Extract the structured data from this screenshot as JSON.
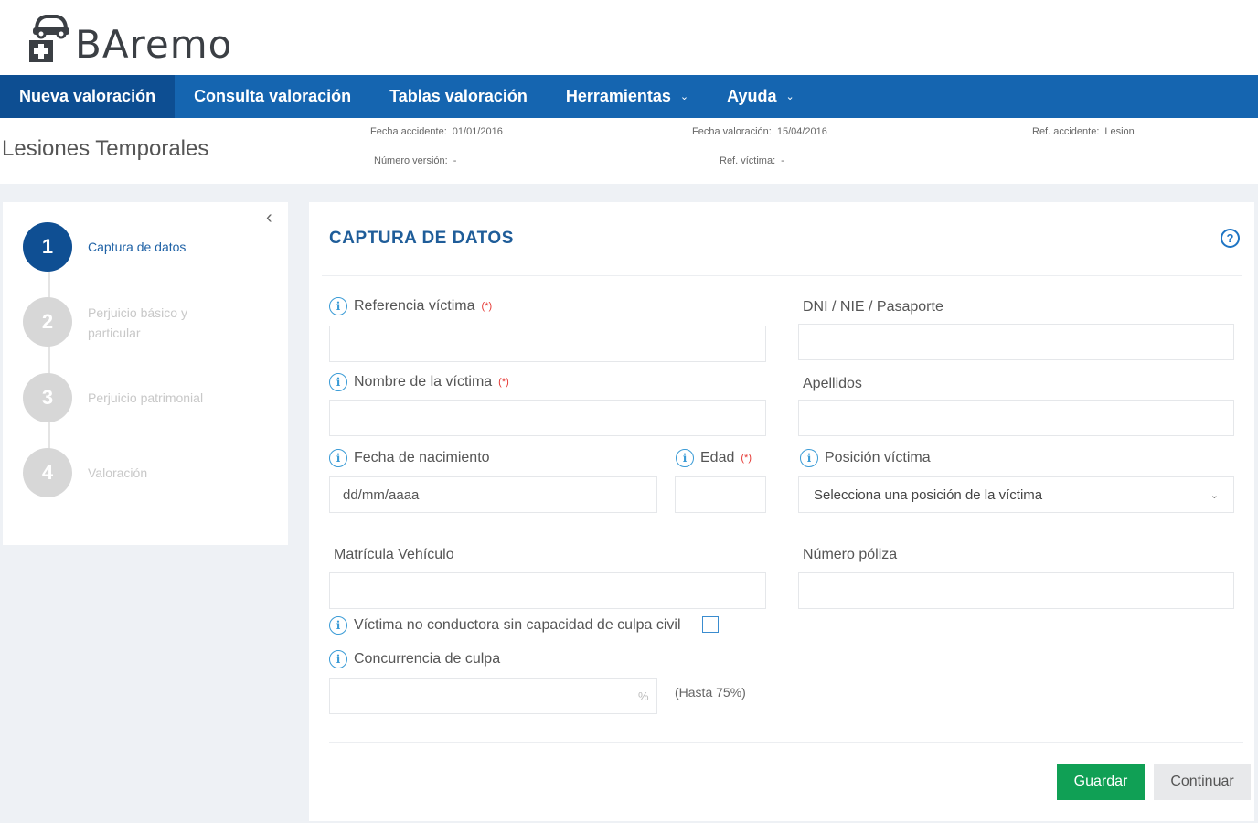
{
  "brand": {
    "name": "BAremo"
  },
  "nav": {
    "items": [
      {
        "label": "Nueva valoración",
        "active": true,
        "dropdown": false
      },
      {
        "label": "Consulta valoración",
        "active": false,
        "dropdown": false
      },
      {
        "label": "Tablas valoración",
        "active": false,
        "dropdown": false
      },
      {
        "label": "Herramientas",
        "active": false,
        "dropdown": true
      },
      {
        "label": "Ayuda",
        "active": false,
        "dropdown": true
      }
    ]
  },
  "page": {
    "title": "Lesiones Temporales",
    "meta": {
      "fecha_accidente_label": "Fecha accidente:",
      "fecha_accidente": "01/01/2016",
      "fecha_valoracion_label": "Fecha valoración:",
      "fecha_valoracion": "15/04/2016",
      "ref_accidente_label": "Ref. accidente:",
      "ref_accidente": "Lesion",
      "numero_version_label": "Número versión:",
      "numero_version": "-",
      "ref_victima_label": "Ref. víctima:",
      "ref_victima": "-"
    }
  },
  "steps": [
    {
      "number": "1",
      "label": "Captura de datos",
      "active": true
    },
    {
      "number": "2",
      "label": "Perjuicio básico y particular",
      "active": false
    },
    {
      "number": "3",
      "label": "Perjuicio patrimonial",
      "active": false
    },
    {
      "number": "4",
      "label": "Valoración",
      "active": false
    }
  ],
  "form": {
    "title": "CAPTURA DE DATOS",
    "required_mark": "(*)",
    "referencia_victima": {
      "label": "Referencia víctima",
      "value": ""
    },
    "dni": {
      "label": "DNI / NIE / Pasaporte",
      "value": ""
    },
    "nombre": {
      "label": "Nombre de la víctima",
      "value": ""
    },
    "apellidos": {
      "label": "Apellidos",
      "value": ""
    },
    "fecha_nacimiento": {
      "label": "Fecha de nacimiento",
      "placeholder": "dd/mm/aaaa"
    },
    "edad": {
      "label": "Edad",
      "value": ""
    },
    "posicion": {
      "label": "Posición víctima",
      "selected": "Selecciona una posición de la víctima"
    },
    "matricula": {
      "label": "Matrícula Vehículo",
      "value": ""
    },
    "poliza": {
      "label": "Número póliza",
      "value": ""
    },
    "no_conductora": {
      "label": "Víctima no conductora sin capacidad de culpa civil",
      "checked": false
    },
    "concurrencia": {
      "label": "Concurrencia de culpa",
      "unit": "%",
      "hint": "(Hasta 75%)"
    }
  },
  "buttons": {
    "save": "Guardar",
    "continue": "Continuar"
  },
  "icons": {
    "logo": "car-medical-icon",
    "help": "help-icon",
    "info": "info-icon",
    "collapse": "chevron-left-icon",
    "dropdown": "chevron-down-icon"
  },
  "colors": {
    "nav": "#1565b0",
    "nav_active": "#0d4e92",
    "step_active": "#0f4f93",
    "title": "#1f5d99",
    "save": "#10a055",
    "required": "#e53935"
  }
}
